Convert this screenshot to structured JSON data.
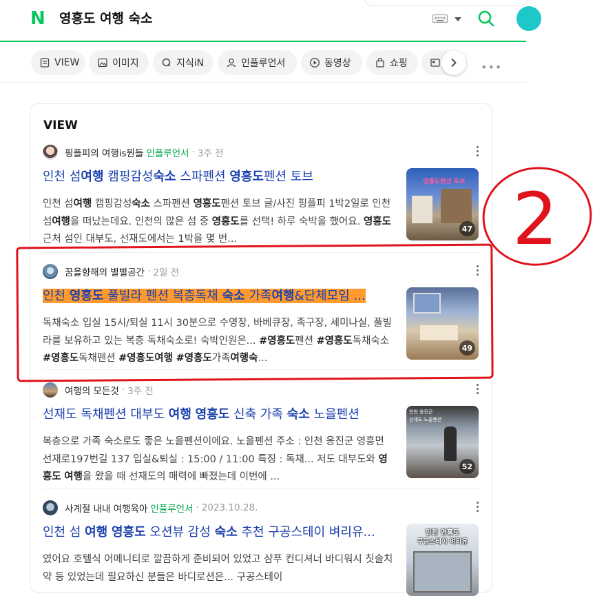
{
  "header": {
    "logo_letter": "N",
    "query": "영흥도 여행 숙소"
  },
  "tabs": [
    {
      "label": "VIEW",
      "icon": "document-icon"
    },
    {
      "label": "이미지",
      "icon": "image-icon"
    },
    {
      "label": "지식iN",
      "icon": "q-icon"
    },
    {
      "label": "인플루언서",
      "icon": "person-icon"
    },
    {
      "label": "동영상",
      "icon": "play-icon"
    },
    {
      "label": "쇼핑",
      "icon": "bag-icon"
    }
  ],
  "section": {
    "title": "VIEW"
  },
  "results": [
    {
      "author": "핑플피의 여행is뭔들",
      "badge": "인플루언서",
      "time": "3주 전",
      "title_parts": [
        "인천 섬",
        "여행",
        " 캠핑감성",
        "숙소",
        " 스파펜션 ",
        "영흥도",
        "펜션 토브"
      ],
      "desc_parts": [
        "인천 섬",
        "여행",
        " 캠핑감성",
        "숙소",
        " 스파펜션 ",
        "영흥도",
        "펜션 토브 글/사진 핑플피 1박2일로 인천 섬",
        "여행",
        "을 떠났는데요. 인천의 많은 섬 중 ",
        "영흥도",
        "를 선택! 하루 숙박을 했어요. ",
        "영흥도",
        " 근처 섬인 대부도, 선재도에서는 1박을 몇 번..."
      ],
      "thumb_count": "47",
      "thumb_caption": "영흥도펜션 토브"
    },
    {
      "author": "꿈을향해의 별별공간",
      "badge": "",
      "time": "2일 전",
      "title_parts": [
        "인천 ",
        "영흥도",
        " 풀빌라 펜션 복층독채 ",
        "숙소",
        " 가족",
        "여행",
        "&단체모임 ..."
      ],
      "desc_parts": [
        "독채숙소 입실 15시/퇴실 11시 30분으로 수영장, 바베큐장, 족구장, 세미나실, 풀빌라를 보유하고 있는 복층 독채숙소로! 숙박인원은... ",
        "#영흥도",
        "펜션 ",
        "#영흥도",
        "독채숙소 ",
        "#영흥도",
        "독채펜션 ",
        "#영흥도여행",
        " ",
        "#영흥도",
        "가족",
        "여행숙",
        "..."
      ],
      "thumb_count": "49"
    },
    {
      "author": "여행의 모든것",
      "badge": "",
      "time": "3주 전",
      "title_parts": [
        "선재도 독채펜션 대부도 ",
        "여행",
        " ",
        "영흥도",
        " 신축 가족 ",
        "숙소",
        " 노을펜션"
      ],
      "desc_parts": [
        "복층으로 가족 숙소로도 좋은 노을펜션이에요. 노을펜션 주소 : 인천 옹진군 영흥면 선재로197번길 137 입실&퇴실 : 15:00 / 11:00 특징 : 독채... 저도 대부도와 ",
        "영흥도",
        " ",
        "여행",
        "을 왔을 때 선재도의 매력에 빠졌는데 이번에 ..."
      ],
      "thumb_count": "52",
      "thumb_caption_1": "인천 옹진군",
      "thumb_caption_2": "선재도 노을펜션"
    },
    {
      "author": "사계절 내내 여행육아",
      "badge": "인플루언서",
      "time": "2023.10.28.",
      "title_parts": [
        "인천 섬 ",
        "여행",
        " ",
        "영흥도",
        " 오션뷰 감성 ",
        "숙소",
        " 추천 구공스테이 벼리유..."
      ],
      "desc_parts": [
        "였어요 호텔식 어메니티로 깔끔하게 준비되어 있었고 샴푸 컨디셔너 바디워시 칫솔치약 등 있었는데 필요하신 분들은 바디로션은... 구공스테이"
      ],
      "thumb_caption_1": "인천 영흥도",
      "thumb_caption_2": "구공스테이 벼리유"
    }
  ],
  "annotation": {
    "label": "2",
    "color": "#e0121b"
  },
  "colors": {
    "brand": "#03c75a",
    "link": "#1a3fae",
    "highlight": "#ff9a2e",
    "influencer": "#03a94e"
  }
}
